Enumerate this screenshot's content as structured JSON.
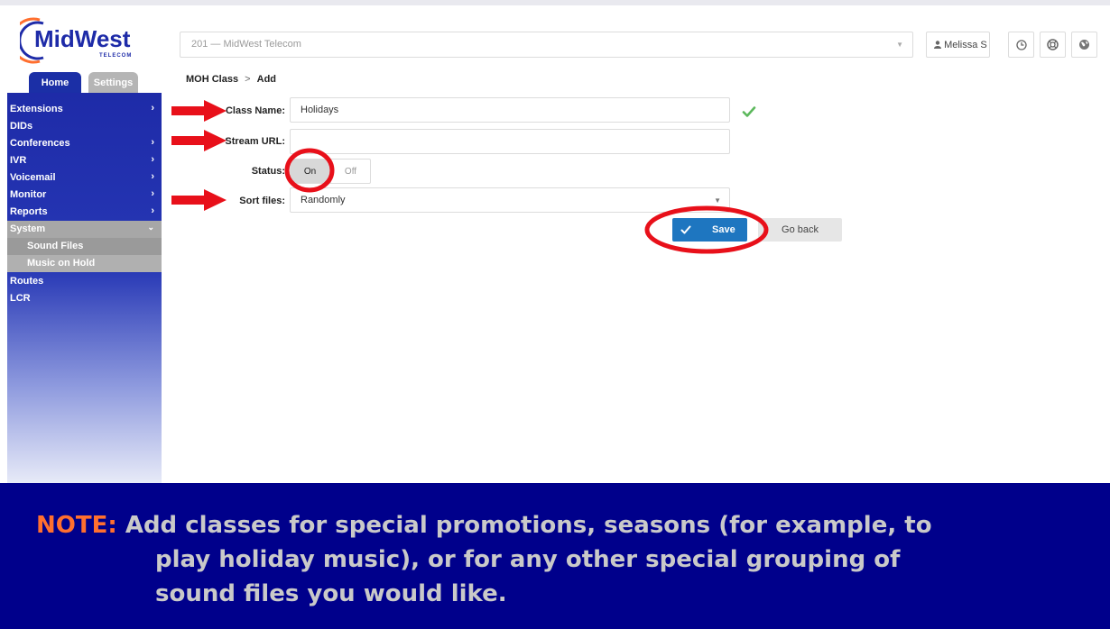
{
  "header": {
    "logo_text": "MidWest",
    "logo_subtext": "TELECOM",
    "account": "201  —  MidWest Telecom",
    "user": "Melissa S"
  },
  "sidebar": {
    "tabs": {
      "home": "Home",
      "settings": "Settings"
    },
    "items": [
      {
        "label": "Extensions",
        "chevron": true
      },
      {
        "label": "DIDs",
        "chevron": false
      },
      {
        "label": "Conferences",
        "chevron": true
      },
      {
        "label": "IVR",
        "chevron": true
      },
      {
        "label": "Voicemail",
        "chevron": true
      },
      {
        "label": "Monitor",
        "chevron": true
      },
      {
        "label": "Reports",
        "chevron": true
      },
      {
        "label": "System",
        "chevron": true
      },
      {
        "label": "Sound Files",
        "chevron": false
      },
      {
        "label": "Music on Hold",
        "chevron": false
      },
      {
        "label": "Routes",
        "chevron": false
      },
      {
        "label": "LCR",
        "chevron": false
      }
    ]
  },
  "breadcrumb": {
    "section": "MOH Class",
    "separator": ">",
    "page": "Add"
  },
  "form": {
    "class_name_label": "Class Name:",
    "class_name_value": "Holidays",
    "stream_url_label": "Stream URL:",
    "stream_url_value": "",
    "status_label": "Status:",
    "status_on": "On",
    "status_off": "Off",
    "status_selected": "On",
    "sort_files_label": "Sort files:",
    "sort_files_value": "Randomly",
    "save_label": "Save",
    "go_back_label": "Go back"
  },
  "note": {
    "label": "NOTE:",
    "line1": "Add classes for special promotions, seasons (for example, to",
    "line2": "play holiday music), or for any other special grouping of",
    "line3": "sound files you would like."
  },
  "colors": {
    "sidebar_blue": "#1e2ba8",
    "save_blue": "#1e76c0",
    "annotation_red": "#e8101a",
    "note_bg": "#00008b",
    "note_label": "#ff6f2f"
  }
}
